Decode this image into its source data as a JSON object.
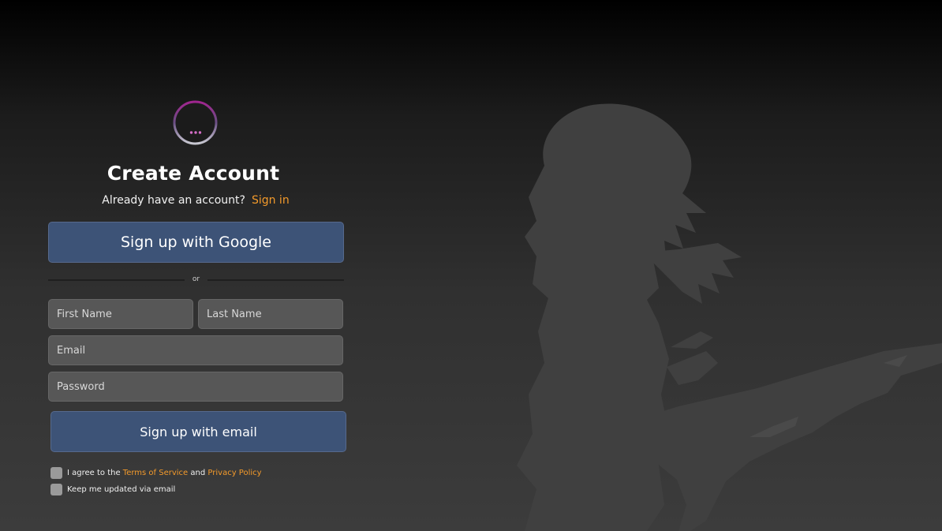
{
  "header": {
    "title": "Create Account",
    "subtitle_text": "Already have an account?",
    "signin_label": "Sign in"
  },
  "buttons": {
    "google_label": "Sign up with Google",
    "email_label": "Sign up with email"
  },
  "divider": {
    "text": "or"
  },
  "form": {
    "first_name_placeholder": "First Name",
    "last_name_placeholder": "Last Name",
    "email_placeholder": "Email",
    "password_placeholder": "Password"
  },
  "agreements": {
    "agree_prefix": "I agree to the",
    "terms_label": "Terms of Service",
    "and_text": "and",
    "privacy_label": "Privacy Policy",
    "updates_label": "Keep me updated via email"
  },
  "icons": {
    "logo": "loading-ring-icon",
    "background": "character-silhouette-icon"
  },
  "colors": {
    "accent": "#f39a2b",
    "button_bg": "#3d5377",
    "field_bg": "#575757",
    "logo_ring_top": "#a0258f"
  }
}
